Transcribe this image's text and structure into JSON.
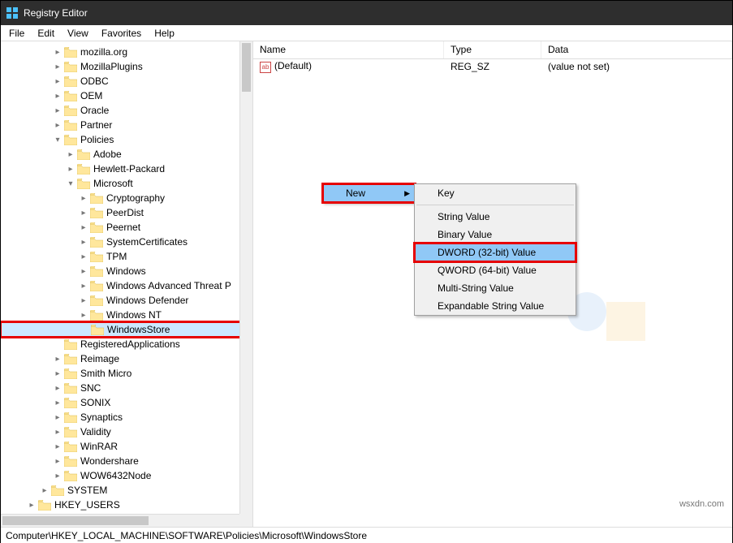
{
  "window": {
    "title": "Registry Editor"
  },
  "menu": {
    "file": "File",
    "edit": "Edit",
    "view": "View",
    "favorites": "Favorites",
    "help": "Help"
  },
  "tree": {
    "root_items": [
      {
        "label": "mozilla.org",
        "indent": 4,
        "exp": "closed"
      },
      {
        "label": "MozillaPlugins",
        "indent": 4,
        "exp": "closed"
      },
      {
        "label": "ODBC",
        "indent": 4,
        "exp": "closed"
      },
      {
        "label": "OEM",
        "indent": 4,
        "exp": "closed"
      },
      {
        "label": "Oracle",
        "indent": 4,
        "exp": "closed"
      },
      {
        "label": "Partner",
        "indent": 4,
        "exp": "closed"
      },
      {
        "label": "Policies",
        "indent": 4,
        "exp": "open"
      },
      {
        "label": "Adobe",
        "indent": 5,
        "exp": "closed"
      },
      {
        "label": "Hewlett-Packard",
        "indent": 5,
        "exp": "closed"
      },
      {
        "label": "Microsoft",
        "indent": 5,
        "exp": "open"
      },
      {
        "label": "Cryptography",
        "indent": 6,
        "exp": "closed"
      },
      {
        "label": "PeerDist",
        "indent": 6,
        "exp": "closed"
      },
      {
        "label": "Peernet",
        "indent": 6,
        "exp": "closed"
      },
      {
        "label": "SystemCertificates",
        "indent": 6,
        "exp": "closed"
      },
      {
        "label": "TPM",
        "indent": 6,
        "exp": "closed"
      },
      {
        "label": "Windows",
        "indent": 6,
        "exp": "closed"
      },
      {
        "label": "Windows Advanced Threat P",
        "indent": 6,
        "exp": "closed"
      },
      {
        "label": "Windows Defender",
        "indent": 6,
        "exp": "closed"
      },
      {
        "label": "Windows NT",
        "indent": 6,
        "exp": "closed"
      },
      {
        "label": "WindowsStore",
        "indent": 6,
        "exp": "none",
        "selected": true,
        "highlight": true
      },
      {
        "label": "RegisteredApplications",
        "indent": 4,
        "exp": "none"
      },
      {
        "label": "Reimage",
        "indent": 4,
        "exp": "closed"
      },
      {
        "label": "Smith Micro",
        "indent": 4,
        "exp": "closed"
      },
      {
        "label": "SNC",
        "indent": 4,
        "exp": "closed"
      },
      {
        "label": "SONIX",
        "indent": 4,
        "exp": "closed"
      },
      {
        "label": "Synaptics",
        "indent": 4,
        "exp": "closed"
      },
      {
        "label": "Validity",
        "indent": 4,
        "exp": "closed"
      },
      {
        "label": "WinRAR",
        "indent": 4,
        "exp": "closed"
      },
      {
        "label": "Wondershare",
        "indent": 4,
        "exp": "closed"
      },
      {
        "label": "WOW6432Node",
        "indent": 4,
        "exp": "closed"
      },
      {
        "label": "SYSTEM",
        "indent": 3,
        "exp": "closed"
      },
      {
        "label": "HKEY_USERS",
        "indent": 2,
        "exp": "closed"
      }
    ]
  },
  "list": {
    "headers": {
      "name": "Name",
      "type": "Type",
      "data": "Data"
    },
    "rows": [
      {
        "name": "(Default)",
        "type": "REG_SZ",
        "data": "(value not set)"
      }
    ]
  },
  "context_menu": {
    "main": [
      {
        "label": "New",
        "sub": true,
        "hover": true,
        "highlight": true
      }
    ],
    "sub": [
      {
        "label": "Key"
      },
      {
        "sep": true
      },
      {
        "label": "String Value"
      },
      {
        "label": "Binary Value"
      },
      {
        "label": "DWORD (32-bit) Value",
        "hover": true,
        "highlight": true
      },
      {
        "label": "QWORD (64-bit) Value"
      },
      {
        "label": "Multi-String Value"
      },
      {
        "label": "Expandable String Value"
      }
    ]
  },
  "statusbar": {
    "path": "Computer\\HKEY_LOCAL_MACHINE\\SOFTWARE\\Policies\\Microsoft\\WindowsStore"
  },
  "watermark": "wsxdn.com"
}
